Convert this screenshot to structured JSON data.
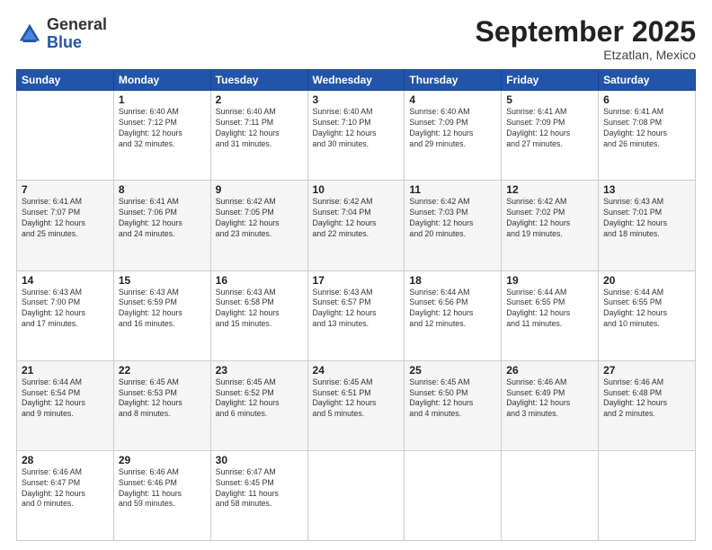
{
  "header": {
    "logo_general": "General",
    "logo_blue": "Blue",
    "month": "September 2025",
    "location": "Etzatlan, Mexico"
  },
  "days_of_week": [
    "Sunday",
    "Monday",
    "Tuesday",
    "Wednesday",
    "Thursday",
    "Friday",
    "Saturday"
  ],
  "weeks": [
    [
      {
        "day": "",
        "info": ""
      },
      {
        "day": "1",
        "info": "Sunrise: 6:40 AM\nSunset: 7:12 PM\nDaylight: 12 hours\nand 32 minutes."
      },
      {
        "day": "2",
        "info": "Sunrise: 6:40 AM\nSunset: 7:11 PM\nDaylight: 12 hours\nand 31 minutes."
      },
      {
        "day": "3",
        "info": "Sunrise: 6:40 AM\nSunset: 7:10 PM\nDaylight: 12 hours\nand 30 minutes."
      },
      {
        "day": "4",
        "info": "Sunrise: 6:40 AM\nSunset: 7:09 PM\nDaylight: 12 hours\nand 29 minutes."
      },
      {
        "day": "5",
        "info": "Sunrise: 6:41 AM\nSunset: 7:09 PM\nDaylight: 12 hours\nand 27 minutes."
      },
      {
        "day": "6",
        "info": "Sunrise: 6:41 AM\nSunset: 7:08 PM\nDaylight: 12 hours\nand 26 minutes."
      }
    ],
    [
      {
        "day": "7",
        "info": "Sunrise: 6:41 AM\nSunset: 7:07 PM\nDaylight: 12 hours\nand 25 minutes."
      },
      {
        "day": "8",
        "info": "Sunrise: 6:41 AM\nSunset: 7:06 PM\nDaylight: 12 hours\nand 24 minutes."
      },
      {
        "day": "9",
        "info": "Sunrise: 6:42 AM\nSunset: 7:05 PM\nDaylight: 12 hours\nand 23 minutes."
      },
      {
        "day": "10",
        "info": "Sunrise: 6:42 AM\nSunset: 7:04 PM\nDaylight: 12 hours\nand 22 minutes."
      },
      {
        "day": "11",
        "info": "Sunrise: 6:42 AM\nSunset: 7:03 PM\nDaylight: 12 hours\nand 20 minutes."
      },
      {
        "day": "12",
        "info": "Sunrise: 6:42 AM\nSunset: 7:02 PM\nDaylight: 12 hours\nand 19 minutes."
      },
      {
        "day": "13",
        "info": "Sunrise: 6:43 AM\nSunset: 7:01 PM\nDaylight: 12 hours\nand 18 minutes."
      }
    ],
    [
      {
        "day": "14",
        "info": "Sunrise: 6:43 AM\nSunset: 7:00 PM\nDaylight: 12 hours\nand 17 minutes."
      },
      {
        "day": "15",
        "info": "Sunrise: 6:43 AM\nSunset: 6:59 PM\nDaylight: 12 hours\nand 16 minutes."
      },
      {
        "day": "16",
        "info": "Sunrise: 6:43 AM\nSunset: 6:58 PM\nDaylight: 12 hours\nand 15 minutes."
      },
      {
        "day": "17",
        "info": "Sunrise: 6:43 AM\nSunset: 6:57 PM\nDaylight: 12 hours\nand 13 minutes."
      },
      {
        "day": "18",
        "info": "Sunrise: 6:44 AM\nSunset: 6:56 PM\nDaylight: 12 hours\nand 12 minutes."
      },
      {
        "day": "19",
        "info": "Sunrise: 6:44 AM\nSunset: 6:55 PM\nDaylight: 12 hours\nand 11 minutes."
      },
      {
        "day": "20",
        "info": "Sunrise: 6:44 AM\nSunset: 6:55 PM\nDaylight: 12 hours\nand 10 minutes."
      }
    ],
    [
      {
        "day": "21",
        "info": "Sunrise: 6:44 AM\nSunset: 6:54 PM\nDaylight: 12 hours\nand 9 minutes."
      },
      {
        "day": "22",
        "info": "Sunrise: 6:45 AM\nSunset: 6:53 PM\nDaylight: 12 hours\nand 8 minutes."
      },
      {
        "day": "23",
        "info": "Sunrise: 6:45 AM\nSunset: 6:52 PM\nDaylight: 12 hours\nand 6 minutes."
      },
      {
        "day": "24",
        "info": "Sunrise: 6:45 AM\nSunset: 6:51 PM\nDaylight: 12 hours\nand 5 minutes."
      },
      {
        "day": "25",
        "info": "Sunrise: 6:45 AM\nSunset: 6:50 PM\nDaylight: 12 hours\nand 4 minutes."
      },
      {
        "day": "26",
        "info": "Sunrise: 6:46 AM\nSunset: 6:49 PM\nDaylight: 12 hours\nand 3 minutes."
      },
      {
        "day": "27",
        "info": "Sunrise: 6:46 AM\nSunset: 6:48 PM\nDaylight: 12 hours\nand 2 minutes."
      }
    ],
    [
      {
        "day": "28",
        "info": "Sunrise: 6:46 AM\nSunset: 6:47 PM\nDaylight: 12 hours\nand 0 minutes."
      },
      {
        "day": "29",
        "info": "Sunrise: 6:46 AM\nSunset: 6:46 PM\nDaylight: 11 hours\nand 59 minutes."
      },
      {
        "day": "30",
        "info": "Sunrise: 6:47 AM\nSunset: 6:45 PM\nDaylight: 11 hours\nand 58 minutes."
      },
      {
        "day": "",
        "info": ""
      },
      {
        "day": "",
        "info": ""
      },
      {
        "day": "",
        "info": ""
      },
      {
        "day": "",
        "info": ""
      }
    ]
  ]
}
